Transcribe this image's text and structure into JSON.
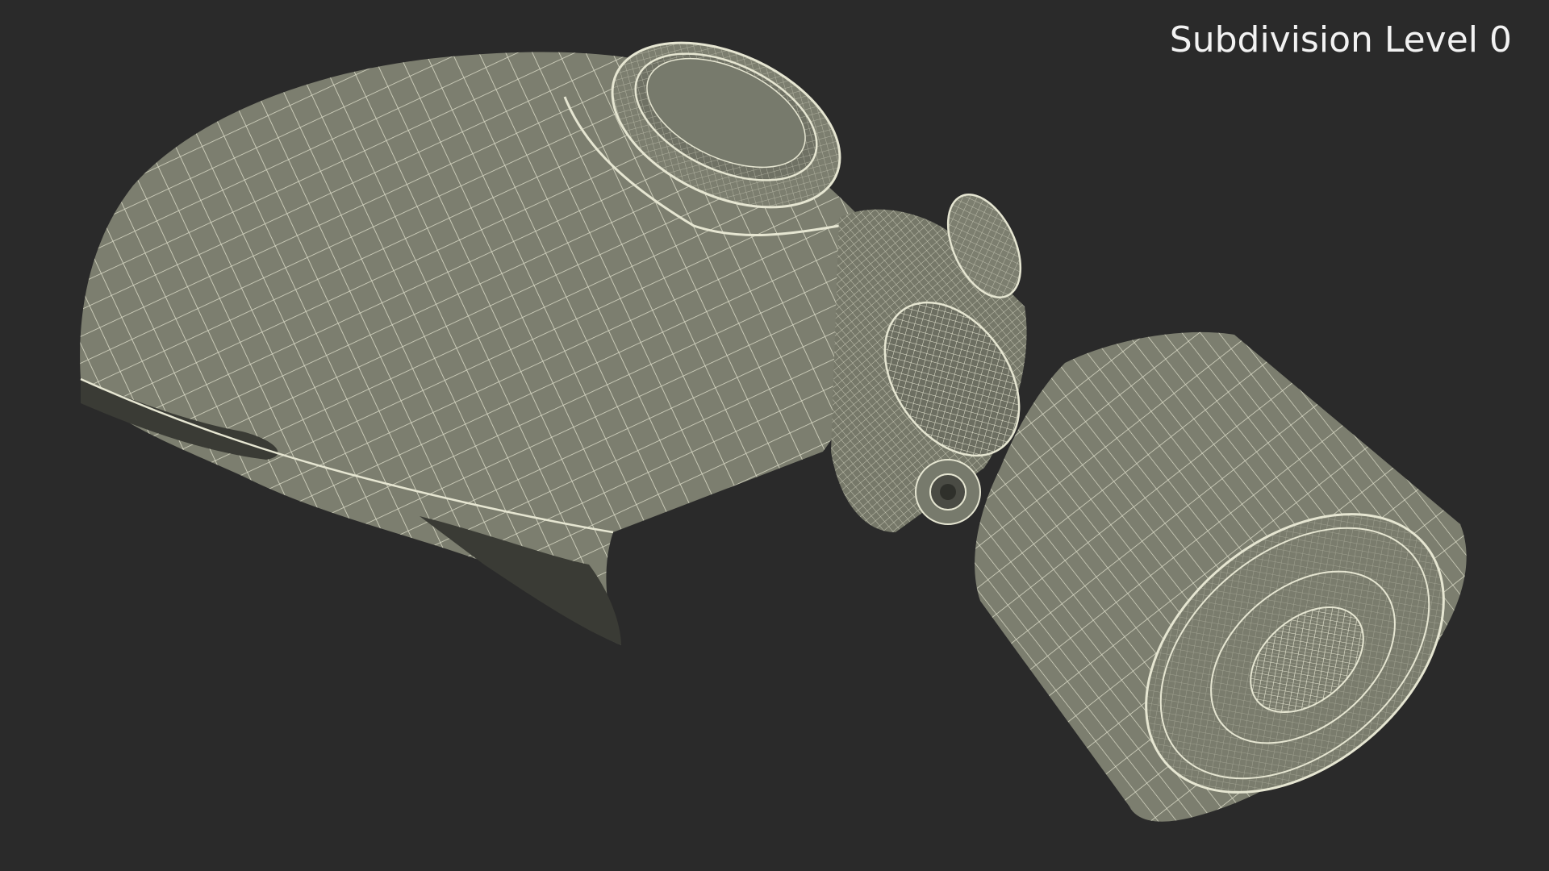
{
  "viewport": {
    "background": "#2a2a2a",
    "label": "Subdivision Level 0"
  },
  "render": {
    "subject": "wireframe-gas-mask-icon",
    "surface_color": "#7c7e6f",
    "shadow_color": "#5e6055",
    "wire_color": "#e6e6d2"
  }
}
